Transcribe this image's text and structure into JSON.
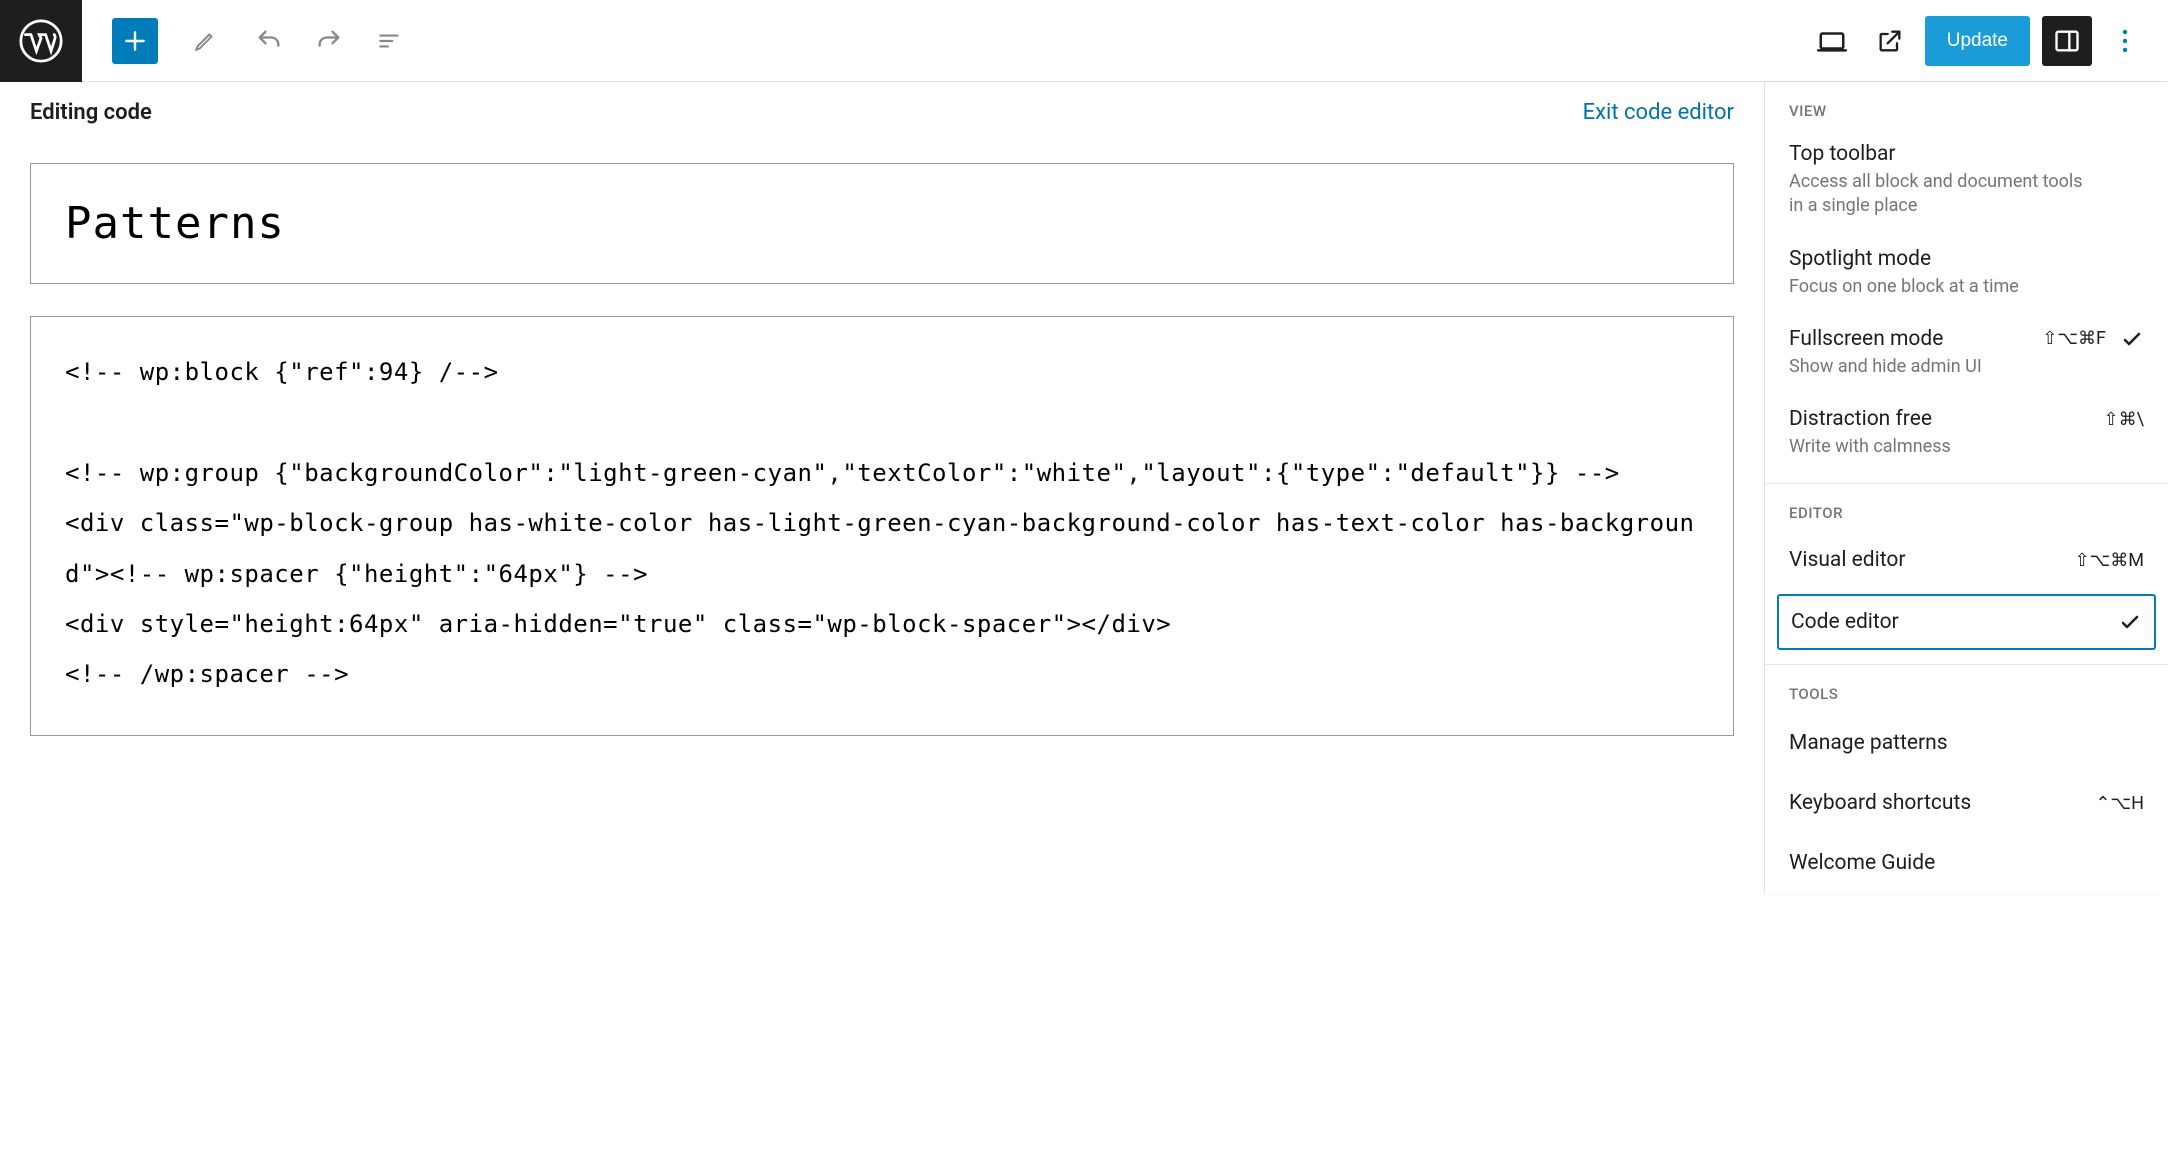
{
  "toolbar": {
    "update_label": "Update"
  },
  "editor": {
    "header_title": "Editing code",
    "exit_label": "Exit code editor",
    "page_title": "Patterns",
    "code_content": "<!-- wp:block {\"ref\":94} /-->\n\n<!-- wp:group {\"backgroundColor\":\"light-green-cyan\",\"textColor\":\"white\",\"layout\":{\"type\":\"default\"}} -->\n<div class=\"wp-block-group has-white-color has-light-green-cyan-background-color has-text-color has-background\"><!-- wp:spacer {\"height\":\"64px\"} -->\n<div style=\"height:64px\" aria-hidden=\"true\" class=\"wp-block-spacer\"></div>\n<!-- /wp:spacer -->"
  },
  "dropdown": {
    "view_label": "VIEW",
    "editor_label": "EDITOR",
    "tools_label": "TOOLS",
    "view_items": [
      {
        "title": "Top toolbar",
        "desc": "Access all block and document tools in a single place",
        "shortcut": "",
        "checked": false
      },
      {
        "title": "Spotlight mode",
        "desc": "Focus on one block at a time",
        "shortcut": "",
        "checked": false
      },
      {
        "title": "Fullscreen mode",
        "desc": "Show and hide admin UI",
        "shortcut": "⇧⌥⌘F",
        "checked": true
      },
      {
        "title": "Distraction free",
        "desc": "Write with calmness",
        "shortcut": "⇧⌘\\",
        "checked": false
      }
    ],
    "editor_items": {
      "visual": {
        "title": "Visual editor",
        "shortcut": "⇧⌥⌘M"
      },
      "code": {
        "title": "Code editor",
        "checked": true
      }
    },
    "tools_items": [
      {
        "title": "Manage patterns",
        "shortcut": ""
      },
      {
        "title": "Keyboard shortcuts",
        "shortcut": "⌃⌥H"
      },
      {
        "title": "Welcome Guide",
        "shortcut": ""
      }
    ]
  }
}
